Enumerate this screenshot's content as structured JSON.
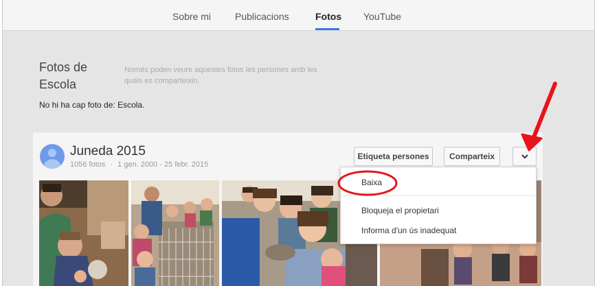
{
  "tabs": [
    {
      "label": "Sobre mi"
    },
    {
      "label": "Publicacions"
    },
    {
      "label": "Fotos",
      "active": true
    },
    {
      "label": "YouTube"
    }
  ],
  "about": {
    "title": "Fotos de Escola",
    "privacy_note": "Només poden veure aquestes fotos les persones amb les quals es comparteixin.",
    "empty_message": "No hi ha cap foto de: Escola."
  },
  "album": {
    "title": "Juneda 2015",
    "photo_count": "1056 fotos",
    "separator": "·",
    "date_range": "1 gen. 2000 - 25 febr. 2015",
    "buttons": {
      "tag_people": "Etiqueta persones",
      "share": "Comparteix",
      "more": "⌄"
    }
  },
  "menu": {
    "items": [
      "Baixa",
      "Bloqueja el propietari",
      "Informa d'un ús inadequat"
    ]
  },
  "colors": {
    "accent": "#3b78e7",
    "annotation": "#e8141b",
    "avatar": "#6d9be8"
  }
}
